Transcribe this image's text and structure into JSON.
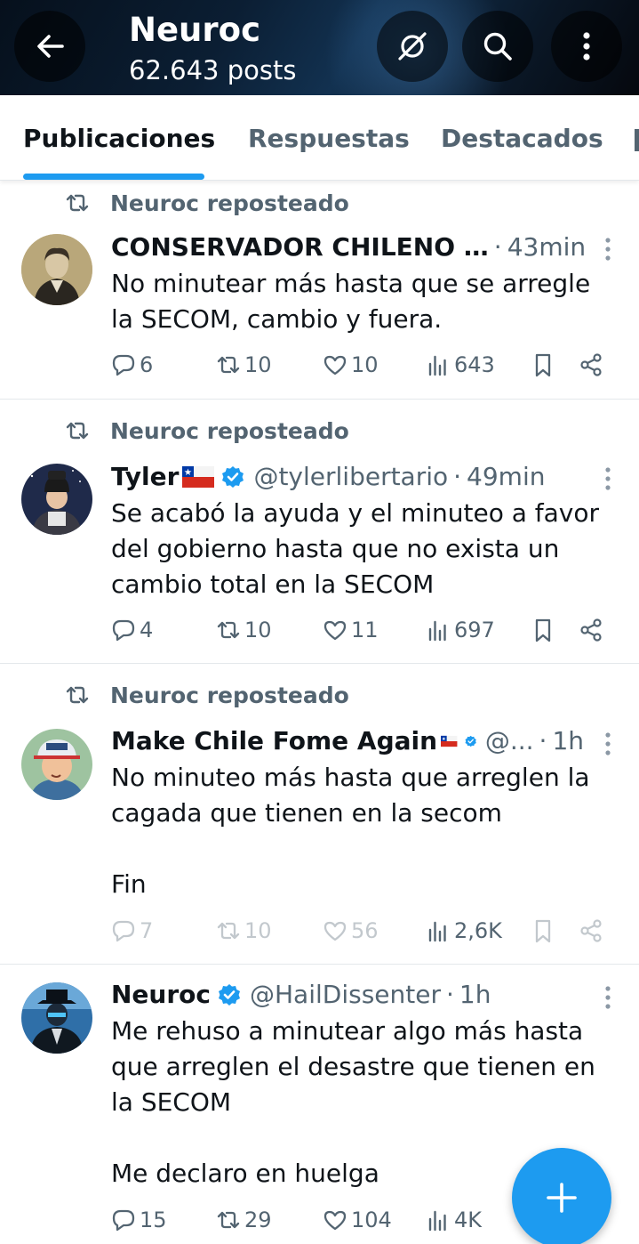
{
  "header": {
    "title": "Neuroc",
    "post_count": "62.643 posts"
  },
  "tabs": [
    {
      "label": "Publicaciones",
      "active": true
    },
    {
      "label": "Respuestas",
      "active": false
    },
    {
      "label": "Destacados",
      "active": false
    }
  ],
  "posts": [
    {
      "repost_label": "Neuroc reposteado",
      "name": "CONSERVADOR CHILENO …",
      "handle": "",
      "time": "43min",
      "text": "No minutear más hasta que se arregle la SECOM, cambio y fuera.",
      "replies": "6",
      "reposts": "10",
      "likes": "10",
      "views": "643"
    },
    {
      "repost_label": "Neuroc reposteado",
      "name": "Tyler",
      "handle": "@tylerlibertario",
      "time": "49min",
      "text": "Se acabó la ayuda y el minuteo a favor del gobierno hasta que no exista un cambio total en la SECOM",
      "replies": "4",
      "reposts": "10",
      "likes": "11",
      "views": "697"
    },
    {
      "repost_label": "Neuroc reposteado",
      "name": "Make Chile Fome Again",
      "handle": "@...",
      "time": "1h",
      "text": "No minuteo más hasta que arreglen la cagada que tienen en la secom\n\nFin",
      "replies": "7",
      "reposts": "10",
      "likes": "56",
      "views": "2,6K"
    },
    {
      "name": "Neuroc",
      "handle": "@HailDissenter",
      "time": "1h",
      "text": "Me rehuso a minutear algo más hasta que arreglen el desastre que tienen en la SECOM\n\nMe declaro en huelga",
      "replies": "15",
      "reposts": "29",
      "likes": "104",
      "views": "4K"
    }
  ],
  "colors": {
    "accent": "#1d9bf0",
    "text_primary": "#0f1419",
    "text_secondary": "#536471"
  }
}
